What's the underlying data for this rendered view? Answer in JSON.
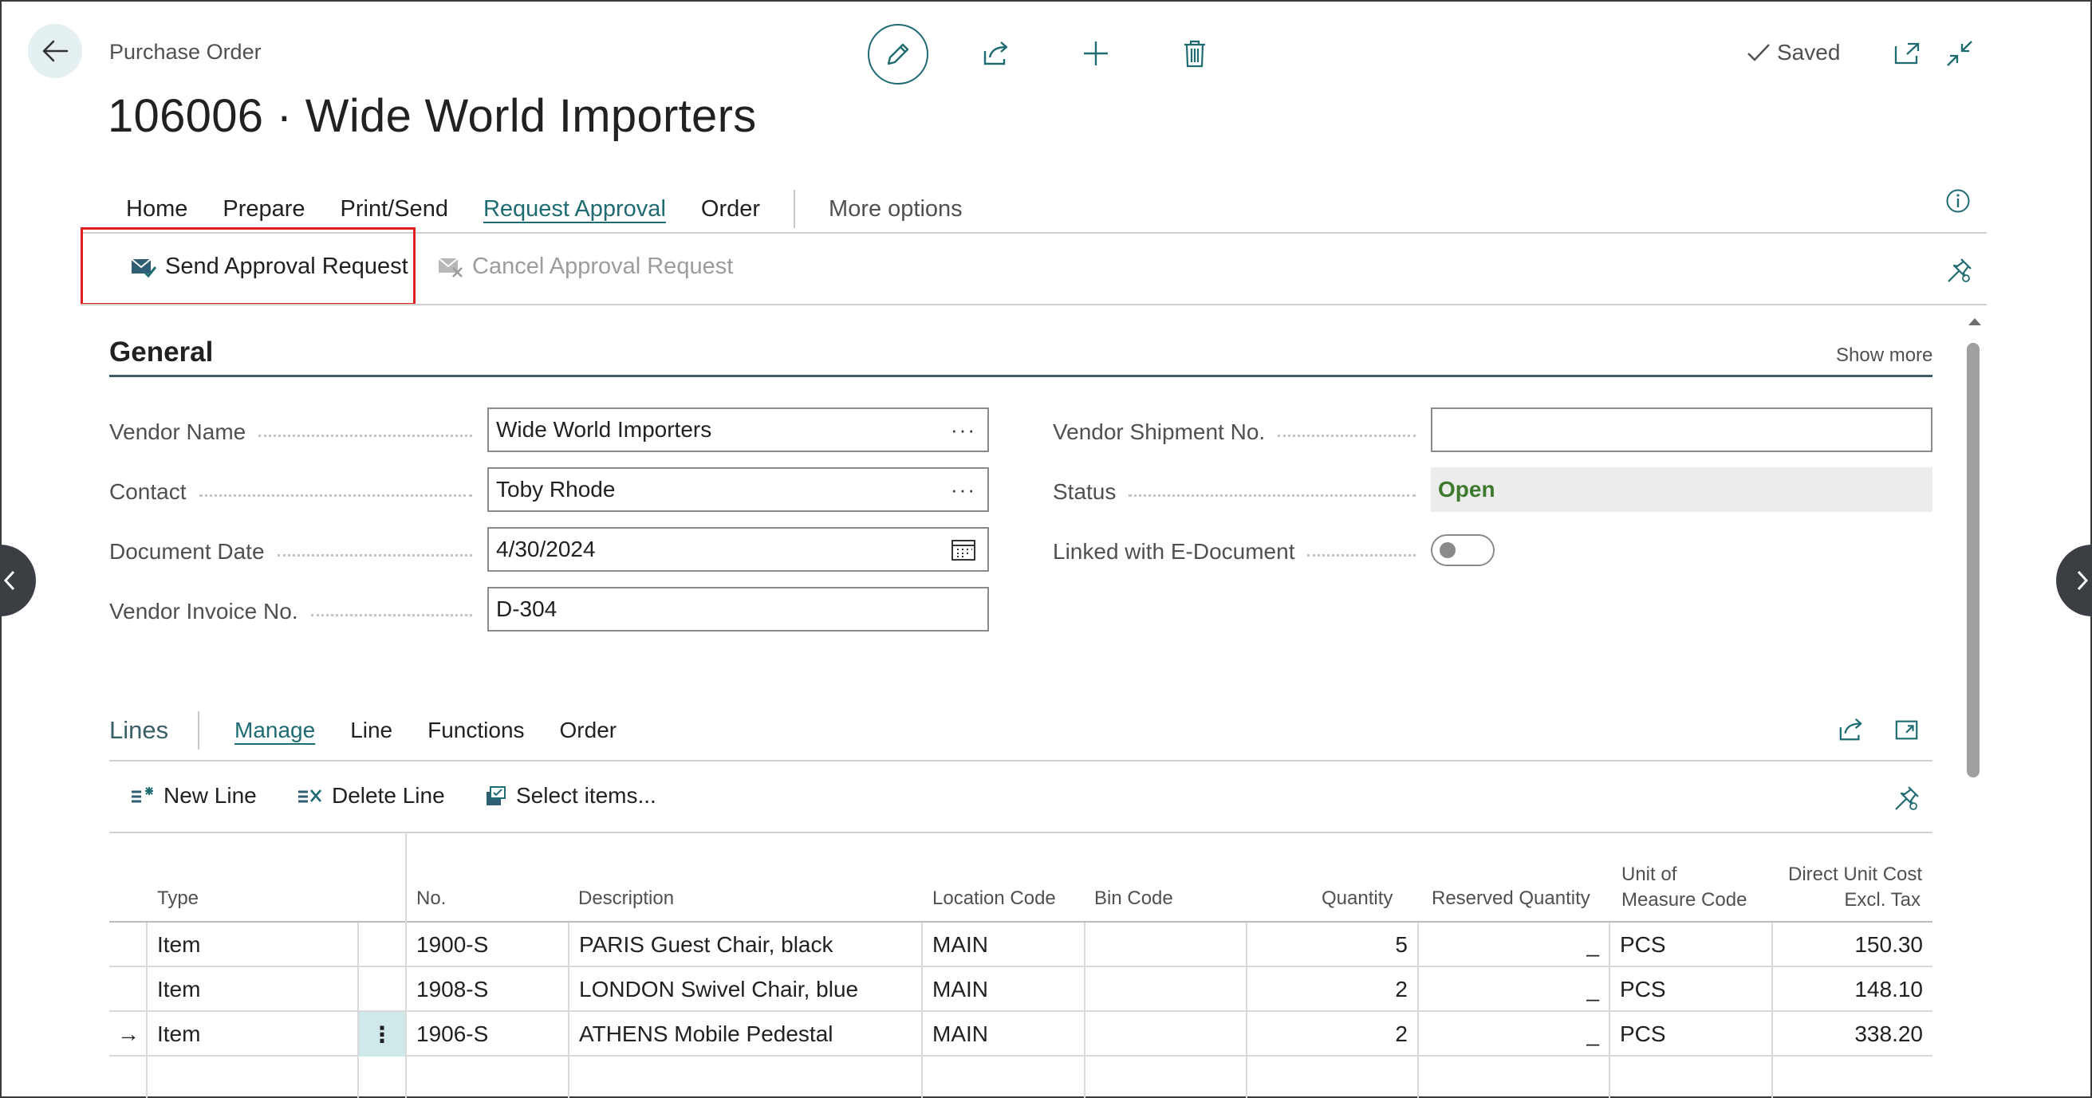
{
  "header": {
    "breadcrumb": "Purchase Order",
    "title": "106006 · Wide World Importers",
    "saved_label": "Saved"
  },
  "action_tabs": [
    {
      "label": "Home"
    },
    {
      "label": "Prepare"
    },
    {
      "label": "Print/Send"
    },
    {
      "label": "Request Approval"
    },
    {
      "label": "Order"
    }
  ],
  "more_options": "More options",
  "actions": {
    "send_approval": "Send Approval Request",
    "cancel_approval": "Cancel Approval Request"
  },
  "general": {
    "title": "General",
    "show_more": "Show more",
    "vendor_name_label": "Vendor Name",
    "vendor_name": "Wide World Importers",
    "contact_label": "Contact",
    "contact": "Toby Rhode",
    "document_date_label": "Document Date",
    "document_date": "4/30/2024",
    "vendor_invoice_label": "Vendor Invoice No.",
    "vendor_invoice": "D-304",
    "vendor_shipment_label": "Vendor Shipment No.",
    "vendor_shipment": "",
    "status_label": "Status",
    "status": "Open",
    "linked_edoc_label": "Linked with E-Document",
    "linked_edoc": false
  },
  "lines": {
    "title": "Lines",
    "tabs": [
      "Manage",
      "Line",
      "Functions",
      "Order"
    ],
    "new_line": "New Line",
    "delete_line": "Delete Line",
    "select_items": "Select items...",
    "columns": {
      "type": "Type",
      "no": "No.",
      "description": "Description",
      "location": "Location Code",
      "bin": "Bin Code",
      "quantity": "Quantity",
      "reserved": "Reserved Quantity",
      "uom_1": "Unit of",
      "uom_2": "Measure Code",
      "cost_1": "Direct Unit Cost",
      "cost_2": "Excl. Tax"
    },
    "rows": [
      {
        "type": "Item",
        "no": "1900-S",
        "description": "PARIS Guest Chair, black",
        "location": "MAIN",
        "bin": "",
        "quantity": "5",
        "reserved": "_",
        "uom": "PCS",
        "cost": "150.30"
      },
      {
        "type": "Item",
        "no": "1908-S",
        "description": "LONDON Swivel Chair, blue",
        "location": "MAIN",
        "bin": "",
        "quantity": "2",
        "reserved": "_",
        "uom": "PCS",
        "cost": "148.10"
      },
      {
        "type": "Item",
        "no": "1906-S",
        "description": "ATHENS Mobile Pedestal",
        "location": "MAIN",
        "bin": "",
        "quantity": "2",
        "reserved": "_",
        "uom": "PCS",
        "cost": "338.20"
      }
    ],
    "row_menu_glyph": "⋮",
    "current_row_glyph": "→"
  },
  "colors": {
    "accent": "#1f6b72",
    "highlight_border": "#e02020",
    "status_open": "#3d7a2e"
  }
}
